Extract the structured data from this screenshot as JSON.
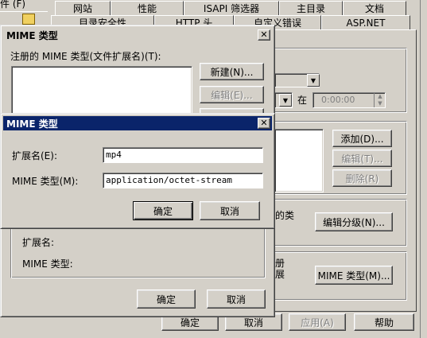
{
  "background_window": {
    "menu_fragment": "件 (F)",
    "tabs_row1": [
      "网站",
      "性能",
      "ISAPI 筛选器",
      "主目录",
      "文档"
    ],
    "tabs_row2": [
      "目录安全性",
      "HTTP 头",
      "自定义错误",
      "ASP.NET"
    ],
    "time_label": "在",
    "time_value": "0:00:00",
    "buttons": {
      "add": "添加(D)...",
      "edit": "编辑(T)...",
      "remove": "删除(R)",
      "edit_rating": "编辑分级(N)...",
      "mime": "MIME 类型(M)...",
      "ok": "确定",
      "cancel": "取消",
      "apply": "应用(A)",
      "help": "帮助"
    },
    "text_fragments": {
      "rating_fragment": "的类",
      "mime_fragment_1": "册",
      "mime_fragment_2": "展"
    }
  },
  "mime_types_dialog": {
    "title": "MIME 类型",
    "registered_label": "注册的 MIME 类型(文件扩展名)(T):",
    "buttons": {
      "new": "新建(N)...",
      "edit": "编辑(E)...",
      "ok": "确定",
      "cancel": "取消"
    },
    "details": {
      "extension_label": "扩展名:",
      "mime_type_label": "MIME 类型:"
    }
  },
  "mime_type_edit_dialog": {
    "title": "MIME 类型",
    "extension_label": "扩展名(E):",
    "extension_value": "mp4",
    "mime_label": "MIME 类型(M):",
    "mime_value": "application/octet-stream",
    "buttons": {
      "ok": "确定",
      "cancel": "取消"
    }
  }
}
